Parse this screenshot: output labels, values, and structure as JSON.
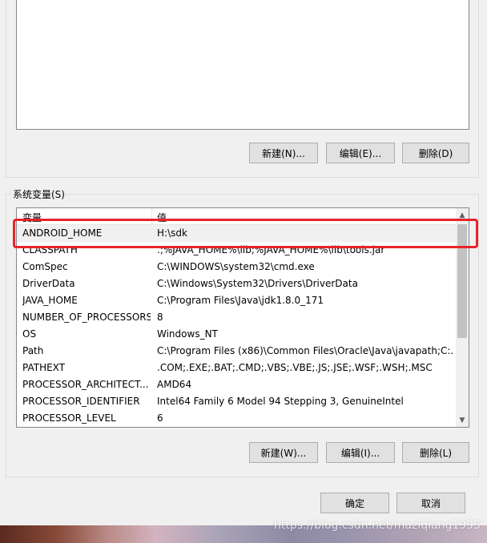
{
  "user_variables": {
    "buttons": {
      "new": "新建(N)...",
      "edit": "编辑(E)...",
      "delete": "删除(D)"
    }
  },
  "system_variables": {
    "group_label": "系统变量(S)",
    "columns": {
      "variable": "变量",
      "value": "值"
    },
    "rows": [
      {
        "name": "ANDROID_HOME",
        "value": "H:\\sdk",
        "selected": true
      },
      {
        "name": "CLASSPATH",
        "value": ".;%JAVA_HOME%\\lib;%JAVA_HOME%\\lib\\tools.jar"
      },
      {
        "name": "ComSpec",
        "value": "C:\\WINDOWS\\system32\\cmd.exe"
      },
      {
        "name": "DriverData",
        "value": "C:\\Windows\\System32\\Drivers\\DriverData"
      },
      {
        "name": "JAVA_HOME",
        "value": "C:\\Program Files\\Java\\jdk1.8.0_171"
      },
      {
        "name": "NUMBER_OF_PROCESSORS",
        "value": "8"
      },
      {
        "name": "OS",
        "value": "Windows_NT"
      },
      {
        "name": "Path",
        "value": "C:\\Program Files (x86)\\Common Files\\Oracle\\Java\\javapath;C:..."
      },
      {
        "name": "PATHEXT",
        "value": ".COM;.EXE;.BAT;.CMD;.VBS;.VBE;.JS;.JSE;.WSF;.WSH;.MSC"
      },
      {
        "name": "PROCESSOR_ARCHITECT...",
        "value": "AMD64"
      },
      {
        "name": "PROCESSOR_IDENTIFIER",
        "value": "Intel64 Family 6 Model 94 Stepping 3, GenuineIntel"
      },
      {
        "name": "PROCESSOR_LEVEL",
        "value": "6"
      }
    ],
    "buttons": {
      "new": "新建(W)...",
      "edit": "编辑(I)...",
      "delete": "删除(L)"
    }
  },
  "dialog_buttons": {
    "ok": "确定",
    "cancel": "取消"
  },
  "watermark": "https://blog.csdn.net/maziqiang1993",
  "colors": {
    "highlight": "#e8232a",
    "selection": "#f0f0f0",
    "dialog_bg": "#f0f0f0"
  }
}
